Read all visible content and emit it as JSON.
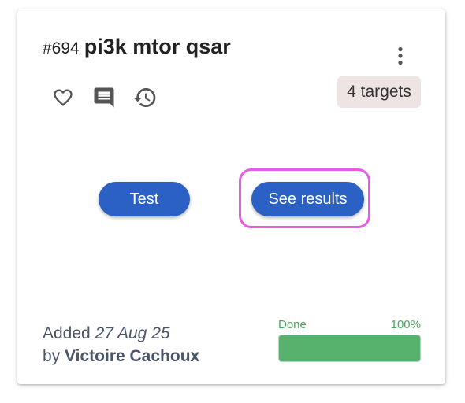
{
  "card": {
    "id_label": "#694",
    "name": "pi3k mtor qsar",
    "targets_label": "4 targets",
    "icons": {
      "favorite": "heart-outline-icon",
      "comments": "comment-icon",
      "history": "history-icon",
      "menu": "more-vertical-icon"
    },
    "buttons": {
      "test_label": "Test",
      "results_label": "See results"
    },
    "added": {
      "prefix": "Added",
      "date": "27 Aug 25",
      "by_prefix": "by",
      "author": "Victoire Cachoux"
    },
    "progress": {
      "status_label": "Done",
      "percent_label": "100%",
      "value": 1.0
    }
  },
  "colors": {
    "primary_button": "#2b60c4",
    "highlight": "#e75ae7",
    "progress_fill": "#57b26e",
    "progress_text": "#46a95a",
    "badge_bg": "#eee4e4"
  }
}
